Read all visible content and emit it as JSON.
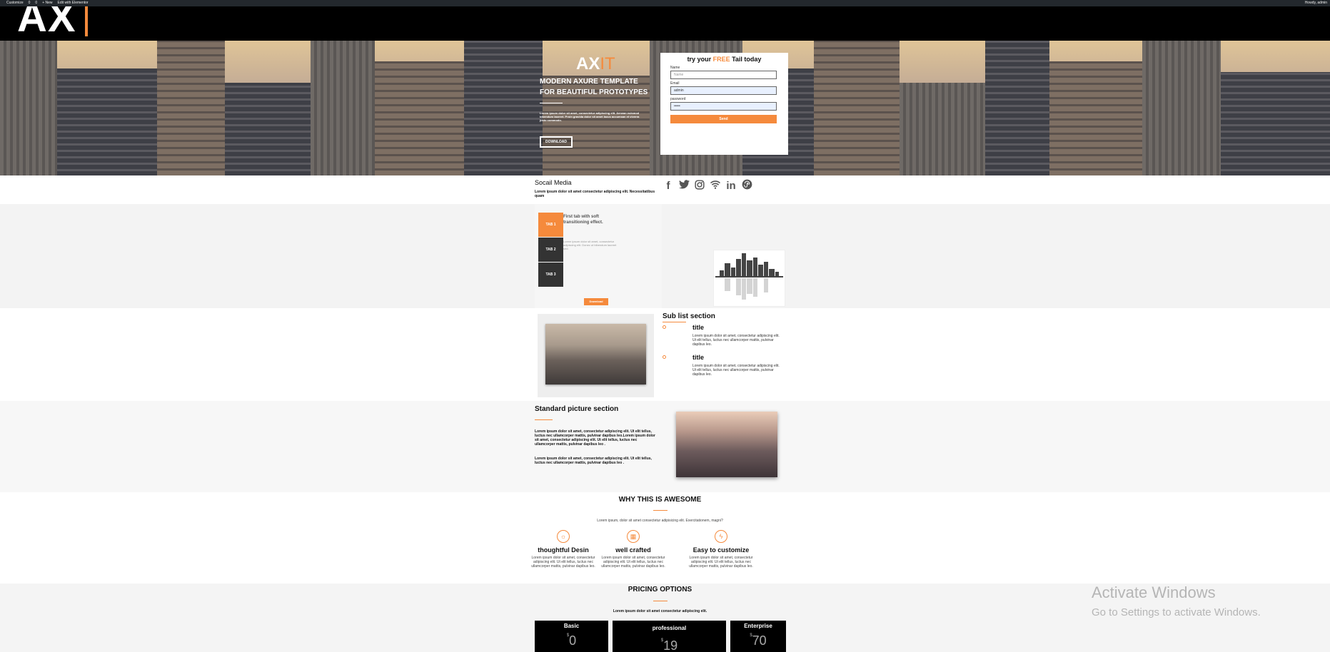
{
  "admin_bar": {
    "items": [
      "",
      "Customize",
      "0",
      "0",
      "+ New",
      "Edit with Elementor"
    ],
    "howdy": "Howdy, admin"
  },
  "header": {
    "logo": "AX"
  },
  "hero": {
    "brand_ax": "AX",
    "brand_it": "IT",
    "headline_1": "MODERN AXURE TEMPLATE",
    "headline_2": "FOR BEAUTIFUL PROTOTYPES",
    "lorem": "Lorem ipsum dolor sit amet, consectetur adipiscing elit. Aenean euismod bibendum laoreet. Proin gravida dolor sit amet lacus accumsan et viverra justo commodo.",
    "button": "DOWNLOAD"
  },
  "signup": {
    "title_pre": "try your ",
    "title_free": "FREE",
    "title_post": " Tail today",
    "name_label": "Name",
    "name_placeholder": "Name",
    "email_label": "Email",
    "email_value": "admin",
    "password_label": "password",
    "password_value": "•••••",
    "send": "Send"
  },
  "social": {
    "title": "Socail Media",
    "desc": "Lorem ipsum dolor sit amet consectetur adipiscing elit. Necessitatibus quam",
    "icons": [
      "facebook-icon",
      "twitter-icon",
      "instagram-icon",
      "wifi-icon",
      "linkedin-icon",
      "stumbleupon-icon"
    ]
  },
  "tabs": {
    "items": [
      "TAB 1",
      "TAB 2",
      "TAB 3"
    ],
    "heading": "First tab with soft transitioning effect.",
    "body": "Lorem ipsum dolor sit amet, consectetur adipiscing elit. Donec ut bibendum laoreet sed.",
    "download": "Download"
  },
  "sublist": {
    "title": "Sub list section",
    "items": [
      {
        "title": "title",
        "text": "Lorem ipsum dolor sit amet, consectetur adipiscing elit. Ut elit tellus, luctus nec ullamcorper mattis, pulvinar dapibus leo."
      },
      {
        "title": "title",
        "text": "Lorem ipsum dolor sit amet, consectetur adipiscing elit. Ut elit tellus, luctus nec ullamcorper mattis, pulvinar dapibus leo."
      }
    ]
  },
  "standard_picture": {
    "title": "Standard picture section",
    "para1": "Lorem ipsum dolor sit amet, consectetur adipiscing elit. Ut elit tellus, luctus nec ullamcorper mattis, pulvinar dapibus leo.Lorem ipsum dolor sit amet, consectetur adipiscing elit. Ut elit tellus, luctus nec ullamcorper mattis, pulvinar dapibus leo .",
    "para2": "Lorem ipsum dolor sit amet, consectetur adipiscing elit. Ut elit tellus, luctus nec ullamcorper mattis, pulvinar dapibus leo ."
  },
  "why": {
    "title": "WHY THIS IS AWESOME",
    "subtitle": "Lorem ipsum, dolor sit amet consectetur adipisicing elit. Exercitationem, magni?",
    "features": [
      {
        "icon": "lightbulb-icon",
        "title": "thoughtful Desin",
        "text": "Lorem ipsum dolor sit amet, consectetur adipiscing elit. Ut elit tellus, luctus nec ullamcorper mattis, pulvinar dapibus leo."
      },
      {
        "icon": "keyboard-icon",
        "title": "well crafted",
        "text": "Lorem ipsum dolor sit amet, consectetur adipiscing elit. Ut elit tellus, luctus nec ullamcorper mattis, pulvinar dapibus leo."
      },
      {
        "icon": "lightning-icon",
        "title": "Easy to customize",
        "text": "Lorem ipsum dolor sit amet, consectetur adipiscing elit. Ut elit tellus, luctus nec ullamcorper mattis, pulvinar dapibus leo."
      }
    ]
  },
  "pricing": {
    "title": "PRICING OPTIONS",
    "subtitle": "Lorem ipsum dolor sit amet consectetur adipiscing elit.",
    "plans": [
      {
        "name": "Basic",
        "price": "0",
        "currency": "$"
      },
      {
        "name": "professional",
        "price": "19",
        "currency": "$"
      },
      {
        "name": "Enterprise",
        "price": "70",
        "currency": "$"
      }
    ]
  },
  "watermark": {
    "line1": "Activate Windows",
    "line2": "Go to Settings to activate Windows."
  },
  "colors": {
    "accent": "#f58a3c",
    "header_bg": "#000000",
    "admin_bar_bg": "#23282d"
  }
}
